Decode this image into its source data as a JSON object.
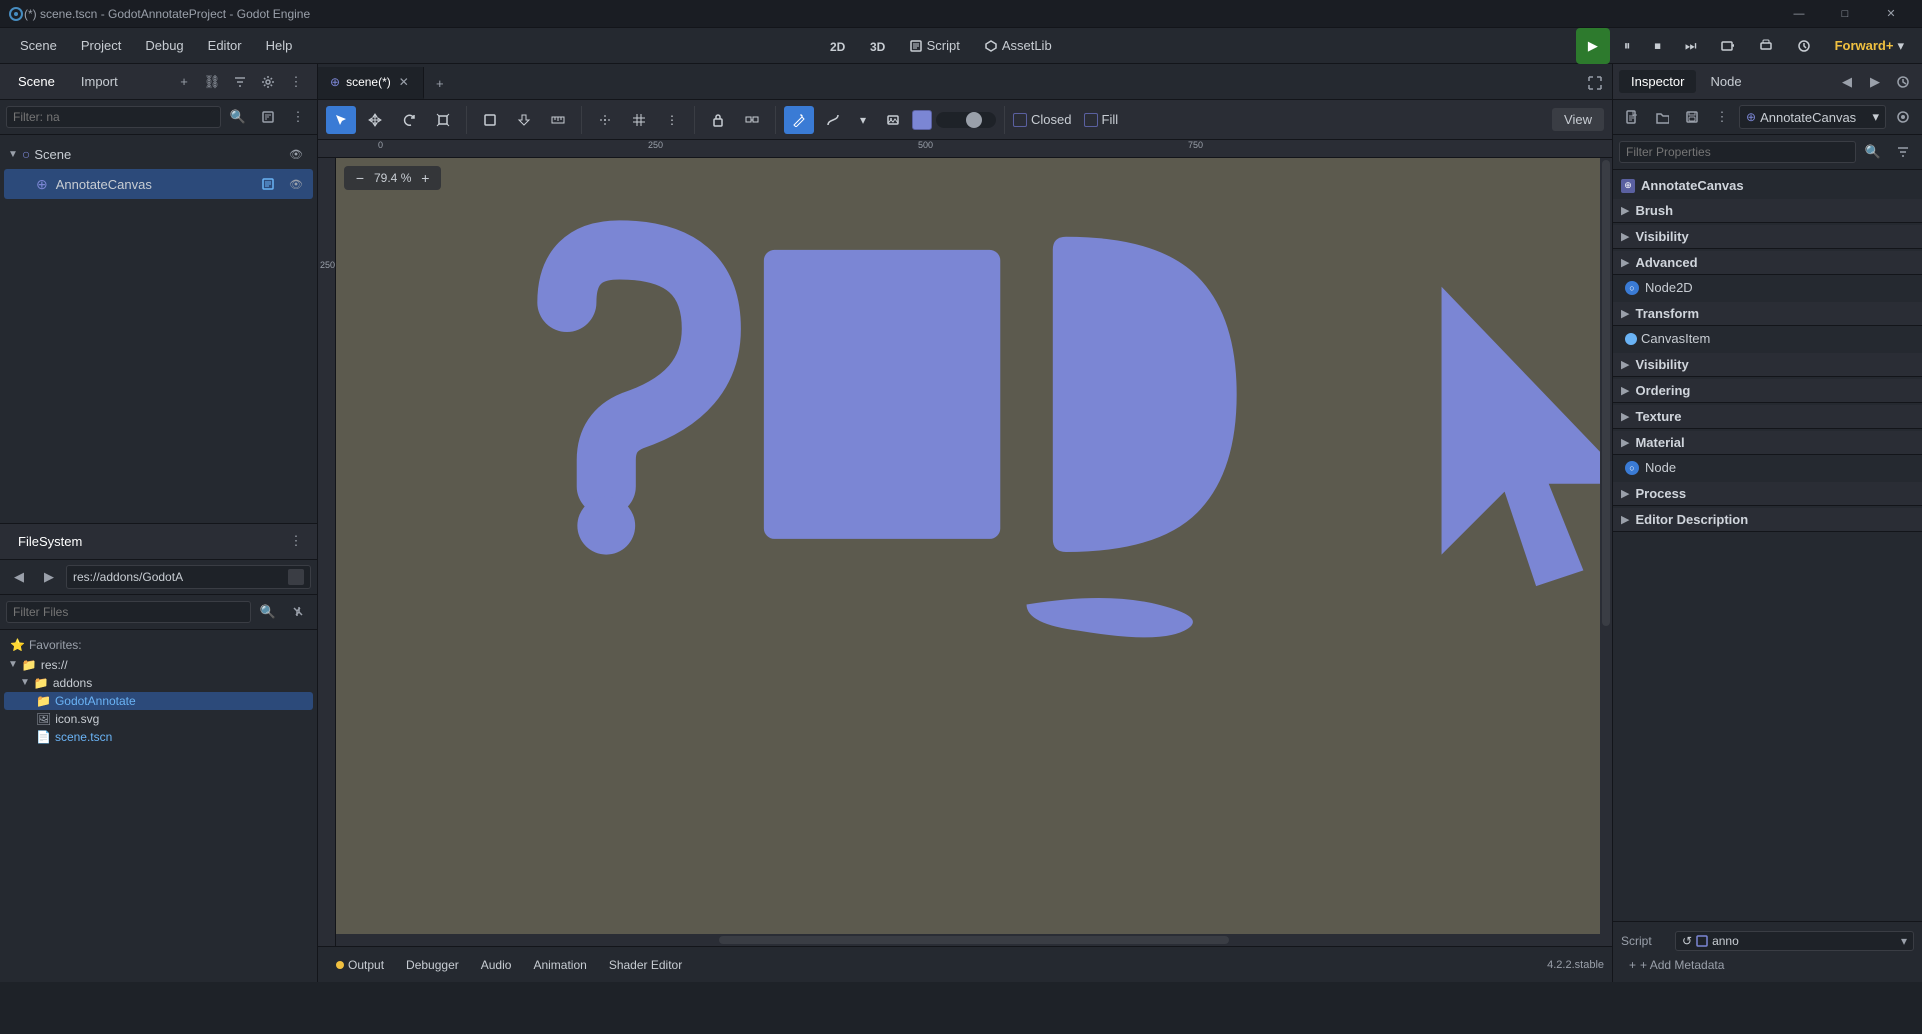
{
  "titlebar": {
    "title": "(*) scene.tscn - GodotAnnotateProject - Godot Engine",
    "min_btn": "—",
    "max_btn": "□",
    "close_btn": "✕"
  },
  "menubar": {
    "items": [
      "Scene",
      "Project",
      "Debug",
      "Editor",
      "Help"
    ]
  },
  "toolbar": {
    "btn_2d": "2D",
    "btn_3d": "3D",
    "btn_script": "Script",
    "btn_assetlib": "AssetLib",
    "forward_plus": "Forward+",
    "forward_dropdown": "▾"
  },
  "scene_panel": {
    "tab_scene": "Scene",
    "tab_import": "Import",
    "filter_placeholder": "Filter: na",
    "tree": [
      {
        "label": "Scene",
        "icon": "○",
        "level": 0,
        "expanded": true
      },
      {
        "label": "AnnotateCanvas",
        "icon": "⊕",
        "level": 1,
        "selected": true
      }
    ]
  },
  "filesystem_panel": {
    "title": "FileSystem",
    "path": "res://addons/GodotA",
    "filter_placeholder": "Filter Files",
    "sections": {
      "favorites": "Favorites:",
      "res": "res://",
      "addons": "addons",
      "godot_annotate": "GodotAnnotate",
      "icon": "icon.svg",
      "scene": "scene.tscn"
    }
  },
  "editor_tabs": {
    "tab_scene": "scene(*)",
    "close_icon": "✕",
    "add_icon": "+"
  },
  "editor_toolbar": {
    "closed_label": "Closed",
    "fill_label": "Fill",
    "view_label": "View",
    "zoom": "79.4 %"
  },
  "canvas": {
    "zoom": "79.4 %",
    "ruler_marks": [
      "0",
      "250",
      "500",
      "750"
    ],
    "shapes": "annotate_canvas_shapes"
  },
  "bottom_panel": {
    "tabs": [
      "Output",
      "Debugger",
      "Audio",
      "Animation",
      "Shader Editor"
    ],
    "output_dot": "●",
    "version": "4.2.2.stable"
  },
  "inspector": {
    "tab_inspector": "Inspector",
    "tab_node": "Node",
    "node_name": "AnnotateCanvas",
    "filter_placeholder": "Filter Properties",
    "sections": {
      "annotate_canvas": "AnnotateCanvas",
      "brush": "Brush",
      "visibility": "Visibility",
      "advanced": "Advanced",
      "node2d": "Node2D",
      "transform": "Transform",
      "canvas_item": "CanvasItem",
      "visibility2": "Visibility",
      "ordering": "Ordering",
      "texture": "Texture",
      "material": "Material",
      "node": "Node",
      "process": "Process",
      "editor_description": "Editor Description"
    },
    "script_label": "Script",
    "script_value": "anno",
    "script_reload": "↺",
    "add_metadata": "+ Add Metadata"
  }
}
